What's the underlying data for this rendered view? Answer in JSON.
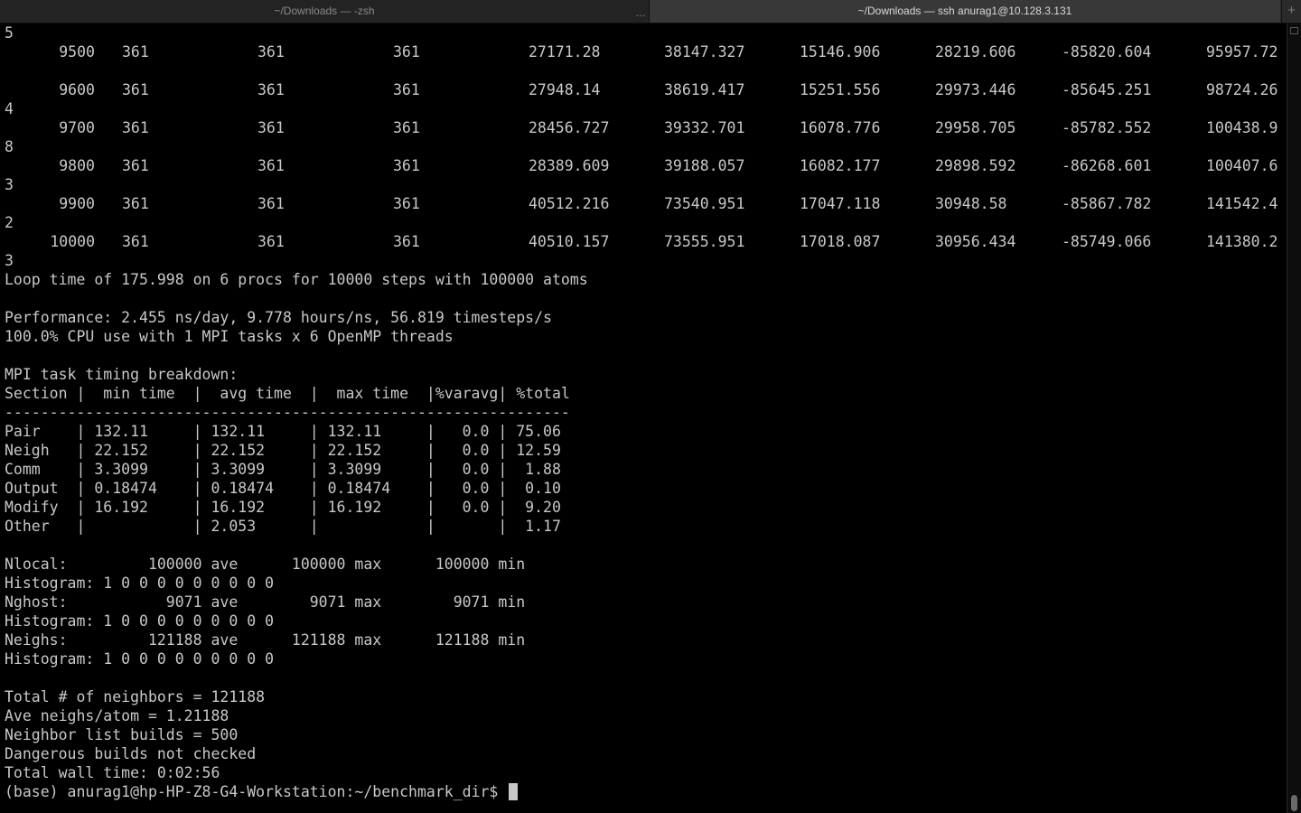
{
  "tabs": [
    {
      "label": "~/Downloads — -zsh",
      "active": false
    },
    {
      "label": "~/Downloads — ssh anurag1@10.128.3.131",
      "active": true
    }
  ],
  "tab_more_label": "…",
  "tab_add_label": "+",
  "thermo_rows": [
    {
      "wrap": "5",
      "step": "9500",
      "c1": "361",
      "c2": "361",
      "c3": "361",
      "v1": "27171.28",
      "v2": "38147.327",
      "v3": "15146.906",
      "v4": "28219.606",
      "v5": "-85820.604",
      "v6": "95957.72"
    },
    {
      "wrap": "",
      "step": "9600",
      "c1": "361",
      "c2": "361",
      "c3": "361",
      "v1": "27948.14",
      "v2": "38619.417",
      "v3": "15251.556",
      "v4": "29973.446",
      "v5": "-85645.251",
      "v6": "98724.26"
    },
    {
      "wrap": "4",
      "step": "9700",
      "c1": "361",
      "c2": "361",
      "c3": "361",
      "v1": "28456.727",
      "v2": "39332.701",
      "v3": "16078.776",
      "v4": "29958.705",
      "v5": "-85782.552",
      "v6": "100438.9"
    },
    {
      "wrap": "8",
      "step": "9800",
      "c1": "361",
      "c2": "361",
      "c3": "361",
      "v1": "28389.609",
      "v2": "39188.057",
      "v3": "16082.177",
      "v4": "29898.592",
      "v5": "-86268.601",
      "v6": "100407.6"
    },
    {
      "wrap": "3",
      "step": "9900",
      "c1": "361",
      "c2": "361",
      "c3": "361",
      "v1": "40512.216",
      "v2": "73540.951",
      "v3": "17047.118",
      "v4": "30948.58",
      "v5": "-85867.782",
      "v6": "141542.4"
    },
    {
      "wrap": "2",
      "step": "10000",
      "c1": "361",
      "c2": "361",
      "c3": "361",
      "v1": "40510.157",
      "v2": "73555.951",
      "v3": "17018.087",
      "v4": "30956.434",
      "v5": "-85749.066",
      "v6": "141380.2"
    }
  ],
  "after_wrap": "3",
  "output_lines": [
    "Loop time of 175.998 on 6 procs for 10000 steps with 100000 atoms",
    "",
    "Performance: 2.455 ns/day, 9.778 hours/ns, 56.819 timesteps/s",
    "100.0% CPU use with 1 MPI tasks x 6 OpenMP threads",
    "",
    "MPI task timing breakdown:",
    "Section |  min time  |  avg time  |  max time  |%varavg| %total",
    "---------------------------------------------------------------",
    "Pair    | 132.11     | 132.11     | 132.11     |   0.0 | 75.06",
    "Neigh   | 22.152     | 22.152     | 22.152     |   0.0 | 12.59",
    "Comm    | 3.3099     | 3.3099     | 3.3099     |   0.0 |  1.88",
    "Output  | 0.18474    | 0.18474    | 0.18474    |   0.0 |  0.10",
    "Modify  | 16.192     | 16.192     | 16.192     |   0.0 |  9.20",
    "Other   |            | 2.053      |            |       |  1.17",
    "",
    "Nlocal:         100000 ave      100000 max      100000 min",
    "Histogram: 1 0 0 0 0 0 0 0 0 0",
    "Nghost:           9071 ave        9071 max        9071 min",
    "Histogram: 1 0 0 0 0 0 0 0 0 0",
    "Neighs:         121188 ave      121188 max      121188 min",
    "Histogram: 1 0 0 0 0 0 0 0 0 0",
    "",
    "Total # of neighbors = 121188",
    "Ave neighs/atom = 1.21188",
    "Neighbor list builds = 500",
    "Dangerous builds not checked",
    "Total wall time: 0:02:56"
  ],
  "prompt": "(base) anurag1@hp-HP-Z8-G4-Workstation:~/benchmark_dir$ "
}
